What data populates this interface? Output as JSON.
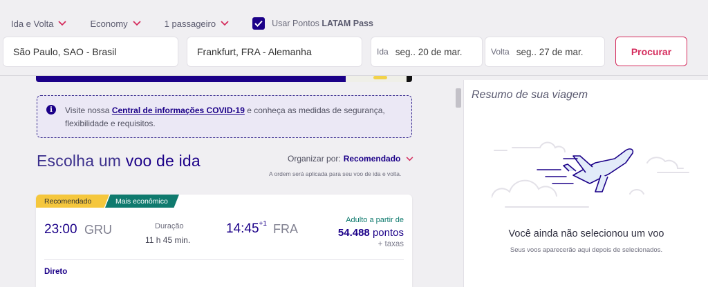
{
  "search": {
    "trip_type": "Ida e Volta",
    "cabin": "Economy",
    "passengers": "1 passageiro",
    "use_points_prefix": "Usar Pontos",
    "use_points_brand": "LATAM Pass",
    "use_points_checked": true,
    "origin": "São Paulo, SAO - Brasil",
    "destination": "Frankfurt, FRA - Alemanha",
    "ida_label": "Ida",
    "ida_value": "seg.. 20 de mar.",
    "volta_label": "Volta",
    "volta_value": "seg.. 27 de mar.",
    "search_button": "Procurar"
  },
  "covid": {
    "prefix": "Visite nossa",
    "link": "Central de informações COVID-19",
    "suffix": "e conheça as medidas de segurança, flexibilidade e requisitos."
  },
  "results": {
    "title_prefix": "Escolha um",
    "title_emphasis": "voo de ida",
    "sort_label": "Organizar por:",
    "sort_value": "Recomendado",
    "sort_note": "A ordem será aplicada para seu voo de ida e volta."
  },
  "flight": {
    "tag_recommended": "Recomendado",
    "tag_cheapest": "Mais econômico",
    "departure_time": "23:00",
    "departure_code": "GRU",
    "duration_label": "Duração",
    "duration_value": "11 h 45 min.",
    "arrival_time": "14:45",
    "arrival_day_offset": "+1",
    "arrival_code": "FRA",
    "price_label": "Adulto a partir de",
    "price_value": "54.488",
    "price_unit": "pontos",
    "price_taxes": "+ taxas",
    "stops": "Direto"
  },
  "summary": {
    "title": "Resumo de sua viagem",
    "empty_title": "Você ainda não selecionou um voo",
    "empty_subtitle": "Seus voos aparecerão aqui depois de selecionados."
  },
  "colors": {
    "brand_primary": "#1b0088",
    "brand_accent": "#d42a5b",
    "tag_yellow": "#f5c73d",
    "tag_green": "#0f7a6e"
  }
}
